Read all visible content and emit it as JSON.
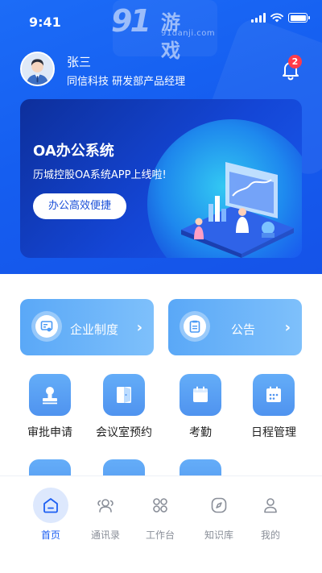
{
  "status_bar": {
    "time": "9:41"
  },
  "watermark": {
    "number": "91",
    "name": "游戏",
    "url": "91danji.com"
  },
  "user": {
    "name": "张三",
    "org": "同信科技 研发部产品经理"
  },
  "notifications": {
    "count": "2"
  },
  "banner": {
    "title": "OA办公系统",
    "subtitle": "历城控股OA系统APP上线啦!",
    "button": "办公高效便捷"
  },
  "quick_links": [
    {
      "label": "企业制度",
      "icon": "certificate-icon"
    },
    {
      "label": "公告",
      "icon": "document-icon"
    }
  ],
  "features": [
    {
      "label": "审批申请",
      "icon": "stamp-icon"
    },
    {
      "label": "会议室预约",
      "icon": "door-icon"
    },
    {
      "label": "考勤",
      "icon": "calendar-icon"
    },
    {
      "label": "日程管理",
      "icon": "schedule-icon"
    }
  ],
  "tabs": [
    {
      "label": "首页",
      "icon": "home-icon",
      "active": true
    },
    {
      "label": "通讯录",
      "icon": "contacts-icon",
      "active": false
    },
    {
      "label": "工作台",
      "icon": "workbench-icon",
      "active": false
    },
    {
      "label": "知识库",
      "icon": "compass-icon",
      "active": false
    },
    {
      "label": "我的",
      "icon": "user-icon",
      "active": false
    }
  ],
  "colors": {
    "primary": "#1d5ff2",
    "tile": "#5aa0f3",
    "badge": "#ff3b4a"
  }
}
